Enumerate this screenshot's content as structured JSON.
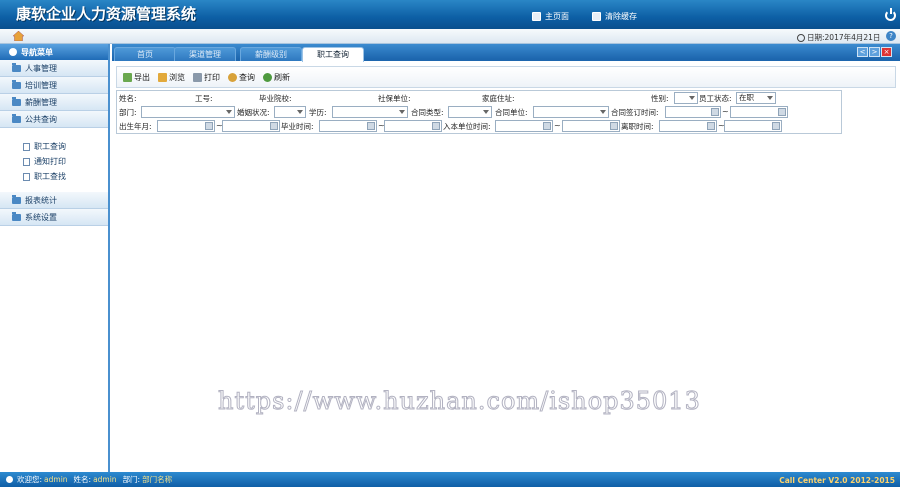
{
  "header": {
    "title": "康软企业人力资源管理系统",
    "home_label": "主页面",
    "clear_label": "清除缓存"
  },
  "topbar": {
    "date": "日期:2017年4月21日"
  },
  "sidebar": {
    "title": "导航菜单",
    "groups": [
      {
        "label": "人事管理"
      },
      {
        "label": "培训管理"
      },
      {
        "label": "薪酬管理"
      },
      {
        "label": "公共查询"
      }
    ],
    "subitems": [
      {
        "label": "职工查询"
      },
      {
        "label": "通知打印"
      },
      {
        "label": "职工查找"
      }
    ],
    "groups2": [
      {
        "label": "报表统计"
      },
      {
        "label": "系统设置"
      }
    ]
  },
  "tabs": [
    {
      "label": "首页"
    },
    {
      "label": "渠道管理"
    },
    {
      "label": "薪酬级别"
    },
    {
      "label": "职工查询"
    }
  ],
  "toolbar": {
    "export": "导出",
    "preview": "浏览",
    "print": "打印",
    "query": "查询",
    "refresh": "刷新"
  },
  "filters": {
    "name": "姓名:",
    "emp_no": "工号:",
    "school": "毕业院校:",
    "insurance": "社保单位:",
    "address": "家庭住址:",
    "gender": "性别:",
    "status": "员工状态:",
    "status_value": "在职",
    "dept": "部门:",
    "marital": "婚姻状况:",
    "education": "学历:",
    "contract_type": "合同类型:",
    "contract_unit": "合同单位:",
    "contract_date": "合同签订时间:",
    "birth": "出生年月:",
    "grad_time": "毕业时间:",
    "join_time": "入本单位时间:",
    "leave_time": "离职时间:"
  },
  "watermark": "https://www.huzhan.com/ishop35013",
  "status": {
    "welcome": "欢迎您:",
    "user": "admin",
    "name_label": "姓名:",
    "name": "admin",
    "dept_label": "部门:",
    "dept": "部门名称",
    "copyright": "Call Center V2.0  2012-2015"
  }
}
